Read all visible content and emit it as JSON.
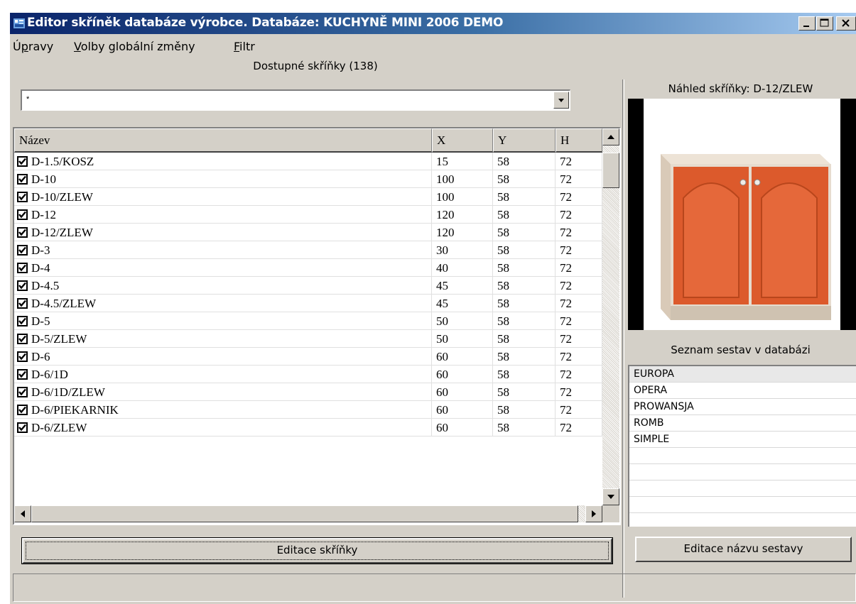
{
  "window": {
    "title": "Editor skříněk databáze výrobce. Databáze: KUCHYNĚ MINI 2006 DEMO"
  },
  "menu": [
    {
      "accel": "Ú",
      "rest_before": "",
      "underlined": "p",
      "rest": "ravy",
      "full": "Úpravy"
    },
    {
      "full": "Volby globální změny"
    },
    {
      "full": "Filtr"
    }
  ],
  "menu_labels": {
    "upravy_pre": "Ú",
    "upravy_acc": "p",
    "upravy_post": "ravy",
    "volby_acc": "V",
    "volby_post": "olby globální změny",
    "filtr_acc": "F",
    "filtr_post": "iltr"
  },
  "left": {
    "header": "Dostupné skříňky (138)",
    "filter_value": "*",
    "columns": [
      "Název",
      "X",
      "Y",
      "H"
    ],
    "rows": [
      {
        "name": "D-1.5/KOSZ",
        "x": "15",
        "y": "58",
        "h": "72",
        "checked": true
      },
      {
        "name": "D-10",
        "x": "100",
        "y": "58",
        "h": "72",
        "checked": true
      },
      {
        "name": "D-10/ZLEW",
        "x": "100",
        "y": "58",
        "h": "72",
        "checked": true
      },
      {
        "name": "D-12",
        "x": "120",
        "y": "58",
        "h": "72",
        "checked": true
      },
      {
        "name": "D-12/ZLEW",
        "x": "120",
        "y": "58",
        "h": "72",
        "checked": true
      },
      {
        "name": "D-3",
        "x": "30",
        "y": "58",
        "h": "72",
        "checked": true
      },
      {
        "name": "D-4",
        "x": "40",
        "y": "58",
        "h": "72",
        "checked": true
      },
      {
        "name": "D-4.5",
        "x": "45",
        "y": "58",
        "h": "72",
        "checked": true
      },
      {
        "name": "D-4.5/ZLEW",
        "x": "45",
        "y": "58",
        "h": "72",
        "checked": true
      },
      {
        "name": "D-5",
        "x": "50",
        "y": "58",
        "h": "72",
        "checked": true
      },
      {
        "name": "D-5/ZLEW",
        "x": "50",
        "y": "58",
        "h": "72",
        "checked": true
      },
      {
        "name": "D-6",
        "x": "60",
        "y": "58",
        "h": "72",
        "checked": true
      },
      {
        "name": "D-6/1D",
        "x": "60",
        "y": "58",
        "h": "72",
        "checked": true
      },
      {
        "name": "D-6/1D/ZLEW",
        "x": "60",
        "y": "58",
        "h": "72",
        "checked": true
      },
      {
        "name": "D-6/PIEKARNIK",
        "x": "60",
        "y": "58",
        "h": "72",
        "checked": true
      },
      {
        "name": "D-6/ZLEW",
        "x": "60",
        "y": "58",
        "h": "72",
        "checked": true
      }
    ],
    "edit_button": "Editace skříňky"
  },
  "right": {
    "preview_header": "Náhled skříňky: D-12/ZLEW",
    "list_header": "Seznam sestav v databázi",
    "sets": [
      "EUROPA",
      "OPERA",
      "PROWANSJA",
      "ROMB",
      "SIMPLE"
    ],
    "selected_set": "EUROPA",
    "edit_button": "Editace názvu sestavy"
  },
  "colors": {
    "titlebar_start": "#0a246a",
    "titlebar_end": "#a6caf0",
    "face": "#d4d0c8",
    "cabinet_door": "#e06030",
    "cabinet_body": "#e8ddd0"
  }
}
